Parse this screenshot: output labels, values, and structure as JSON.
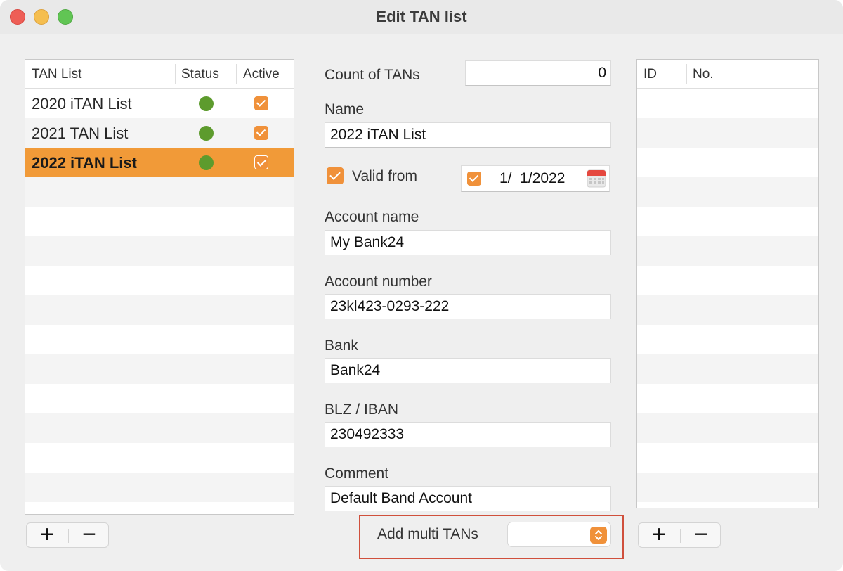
{
  "window": {
    "title": "Edit TAN list"
  },
  "tan_list": {
    "columns": [
      "TAN List",
      "Status",
      "Active"
    ],
    "rows": [
      {
        "name": "2020 iTAN List",
        "status": "active",
        "active": true
      },
      {
        "name": "2021 TAN List",
        "status": "active",
        "active": true
      },
      {
        "name": "2022 iTAN List",
        "status": "active",
        "active": true,
        "selected": true
      }
    ],
    "status_color": "#5d9b2d",
    "selection_color": "#f19a38"
  },
  "form": {
    "count_label": "Count of TANs",
    "count_value": "0",
    "name_label": "Name",
    "name_value": "2022 iTAN List",
    "valid_from_label": "Valid from",
    "valid_from_checked": true,
    "valid_from_date": "1/  1/2022",
    "account_name_label": "Account name",
    "account_name_value": "My Bank24",
    "account_number_label": "Account number",
    "account_number_value": "23kl423-0293-222",
    "bank_label": "Bank",
    "bank_value": "Bank24",
    "blz_label": "BLZ / IBAN",
    "blz_value": "230492333",
    "comment_label": "Comment",
    "comment_value": "Default Band Account",
    "add_multi_label": "Add multi TANs",
    "add_multi_value": ""
  },
  "tans_table": {
    "columns": [
      "ID",
      "No."
    ]
  },
  "buttons": {
    "add": "+",
    "remove": "−"
  },
  "colors": {
    "accent": "#f0913a",
    "highlight_border": "#d0503c"
  }
}
